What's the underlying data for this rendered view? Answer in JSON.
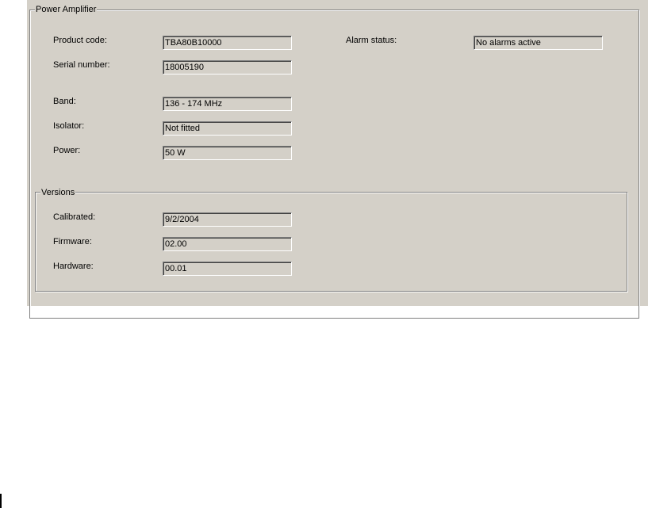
{
  "group": {
    "title": "Power Amplifier"
  },
  "fields": {
    "product_code": {
      "label": "Product code:",
      "value": "TBA80B10000"
    },
    "serial_number": {
      "label": "Serial number:",
      "value": "18005190"
    },
    "band": {
      "label": "Band:",
      "value": "136 - 174 MHz"
    },
    "isolator": {
      "label": "Isolator:",
      "value": "Not fitted"
    },
    "power": {
      "label": "Power:",
      "value": "50 W"
    }
  },
  "alarm": {
    "label": "Alarm status:",
    "indicator_icon": "green-led-icon",
    "indicator_color": "#00e000",
    "value": "No alarms active"
  },
  "versions": {
    "title": "Versions",
    "calibrated": {
      "label": "Calibrated:",
      "value": "9/2/2004"
    },
    "firmware": {
      "label": "Firmware:",
      "value": "02.00"
    },
    "hardware": {
      "label": "Hardware:",
      "value": "00.01"
    }
  },
  "colors": {
    "panel_background": "#d4d0c8",
    "window_background": "#ffffff"
  }
}
